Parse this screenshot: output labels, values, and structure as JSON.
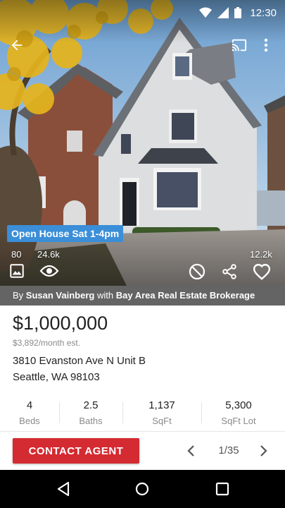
{
  "status_bar": {
    "time": "12:30",
    "icons": [
      "wifi-icon",
      "cell-signal-icon",
      "battery-icon"
    ]
  },
  "toolbar": {
    "icons": [
      "back-arrow-icon",
      "cast-icon",
      "more-vert-icon"
    ]
  },
  "listing": {
    "open_house": "Open House Sat 1-4pm",
    "photo_count": "80",
    "views": "24.6k",
    "favorites": "12.2k",
    "attribution": {
      "by": "By",
      "agent": "Susan Vainberg",
      "with": "with",
      "brokerage": "Bay Area Real Estate Brokerage"
    },
    "price": "$1,000,000",
    "monthly": "$3,892/month est.",
    "address_line1": "3810 Evanston Ave N Unit B",
    "address_line2": "Seattle, WA 98103",
    "stats": [
      {
        "value": "4",
        "label": "Beds"
      },
      {
        "value": "2.5",
        "label": "Baths"
      },
      {
        "value": "1,137",
        "label": "SqFt"
      },
      {
        "value": "5,300",
        "label": "SqFt Lot"
      }
    ]
  },
  "actions": {
    "contact_label": "CONTACT AGENT",
    "pager": "1/35",
    "accent_color": "#d42a31",
    "open_house_color": "#3b8ed8"
  },
  "photo_action_icons": [
    "gallery-icon",
    "eye-icon",
    "hide-icon",
    "share-icon",
    "heart-icon"
  ],
  "nav_bar": {
    "icons": [
      "nav-back-icon",
      "nav-home-icon",
      "nav-recents-icon"
    ]
  }
}
